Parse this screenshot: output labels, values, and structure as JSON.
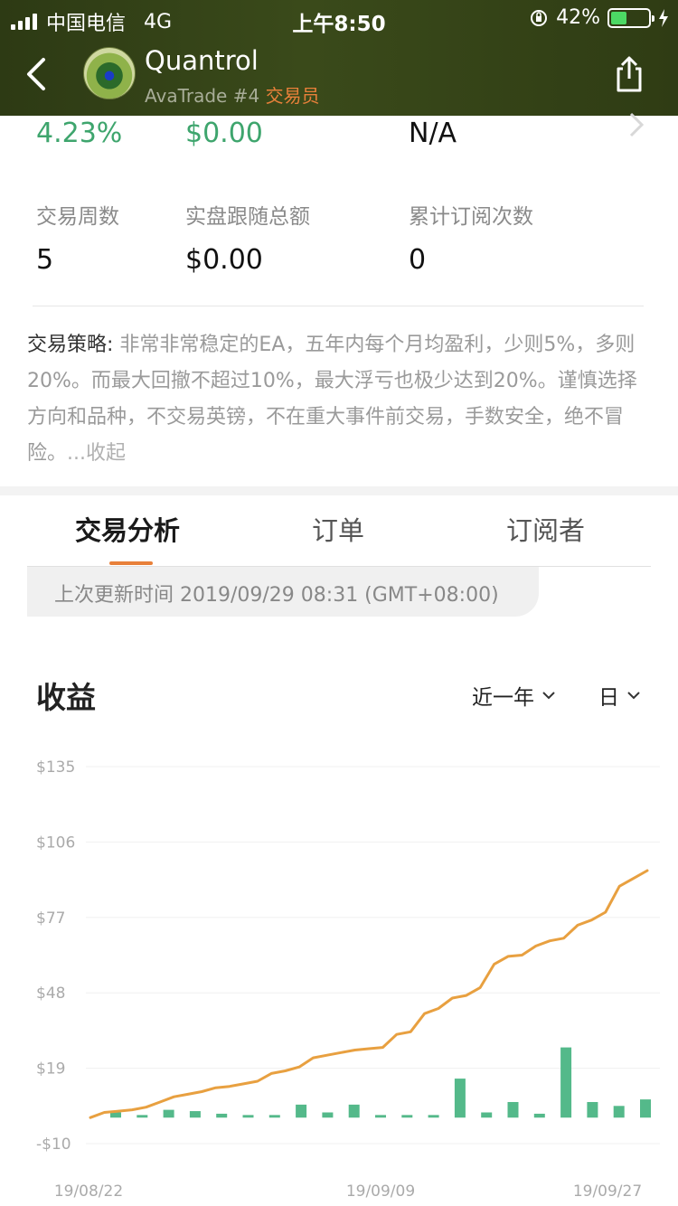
{
  "status_bar": {
    "carrier": "中国电信",
    "network": "4G",
    "time": "上午8:50",
    "battery_percent": "42%",
    "battery_level": 0.42
  },
  "trader": {
    "name": "Quantrol",
    "broker_rank": "AvaTrade #4",
    "role": "交易员"
  },
  "stats_top": {
    "value_1": "4.23%",
    "value_2": "$0.00",
    "value_3": "N/A"
  },
  "stats": {
    "weeks_label": "交易周数",
    "weeks_value": "5",
    "follow_total_label": "实盘跟随总额",
    "follow_total_value": "$0.00",
    "subscriptions_label": "累计订阅次数",
    "subscriptions_value": "0"
  },
  "strategy": {
    "label": "交易策略:",
    "text": " 非常非常稳定的EA，五年内每个月均盈利，少则5%，多则20%。而最大回撤不超过10%，最大浮亏也极少达到20%。谨慎选择方向和品种，不交易英镑，不在重大事件前交易，手数安全，绝不冒险。",
    "collapse": "...收起"
  },
  "tabs": [
    "交易分析",
    "订单",
    "订阅者"
  ],
  "active_tab": 0,
  "update_time": "上次更新时间 2019/09/29 08:31 (GMT+08:00)",
  "chart_section": {
    "title": "收益",
    "range_select": "近一年",
    "period_select": "日"
  },
  "colors": {
    "accent": "#e8803a",
    "positive": "#3ea56d",
    "bar": "#54b98a",
    "line": "#e8a040"
  },
  "chart_data": {
    "type": "line",
    "ylim": [
      -10,
      135
    ],
    "yticks": [
      "$135",
      "$106",
      "$77",
      "$48",
      "$19",
      "-$10"
    ],
    "ytick_values": [
      135,
      106,
      77,
      48,
      19,
      -10
    ],
    "xticks": [
      "19/08/22",
      "19/09/09",
      "19/09/27"
    ],
    "line_series": {
      "values": [
        0,
        2,
        2.5,
        3,
        4,
        6,
        8,
        9,
        10,
        11.5,
        12,
        13,
        14,
        17,
        18,
        19.5,
        23,
        24,
        25,
        26,
        26.5,
        27,
        32,
        33,
        40,
        42,
        46,
        47,
        50,
        59,
        62,
        62.5,
        66,
        68,
        69,
        74,
        76,
        79,
        89,
        92,
        95
      ]
    },
    "bar_series": {
      "values": [
        2,
        1,
        3,
        2.5,
        1.5,
        1,
        1,
        5,
        2,
        5,
        1,
        1,
        1,
        15,
        2,
        6,
        1.5,
        27,
        6,
        4.5,
        7
      ]
    }
  }
}
